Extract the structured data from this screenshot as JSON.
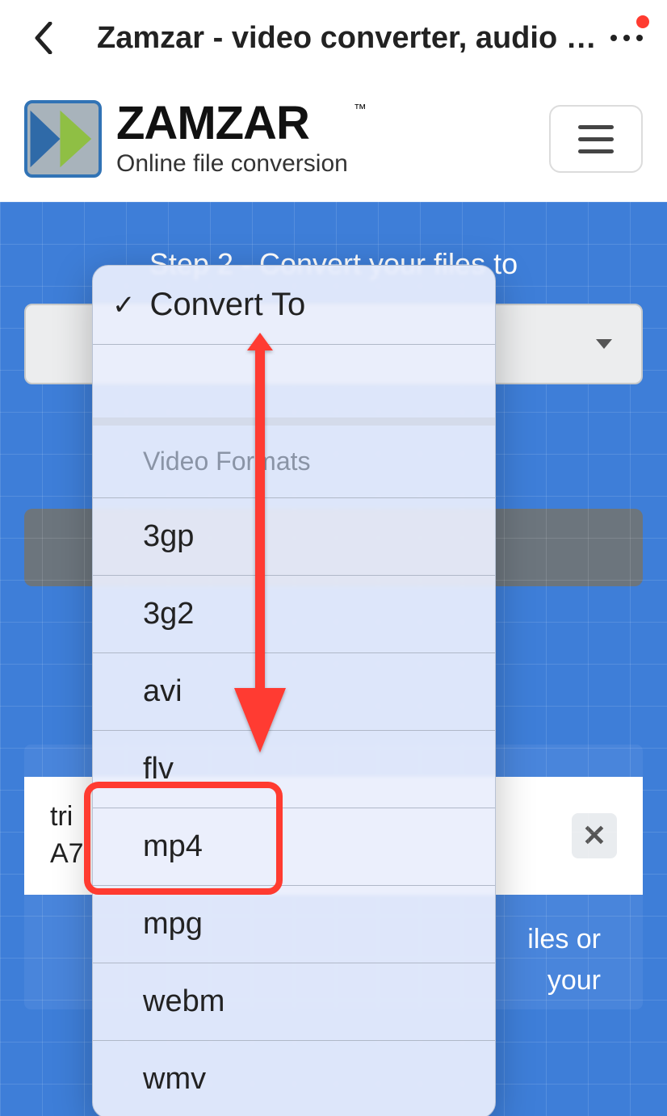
{
  "topbar": {
    "title": "Zamzar - video converter, audio con..."
  },
  "site": {
    "brand": "ZAMZAR",
    "tm": "™",
    "tagline": "Online file conversion"
  },
  "step": {
    "title": "Step 2 - Convert your files to"
  },
  "dropdown": {
    "selected_label": "Convert To",
    "group_label": "Video Formats",
    "options": [
      "3gp",
      "3g2",
      "avi",
      "flv",
      "mp4",
      "mpg",
      "webm",
      "wmv"
    ]
  },
  "file": {
    "line1": "tri",
    "line2": "A7"
  },
  "partial": {
    "line1": "iles or",
    "line2": "your"
  }
}
